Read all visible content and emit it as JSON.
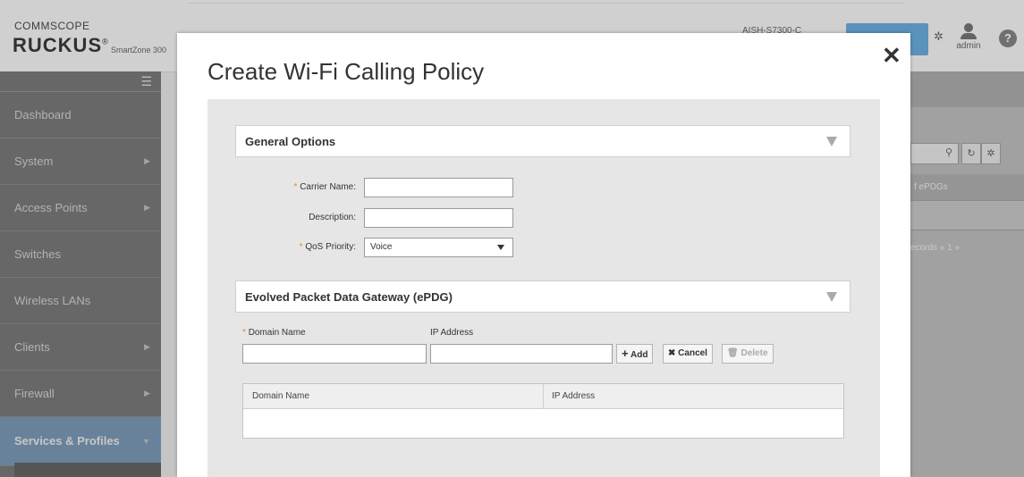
{
  "app": {
    "brand_top": "COMMSCOPE",
    "brand_main": "RUCKUS",
    "brand_reg": "®",
    "brand_sub": "SmartZone 300",
    "host": "AISH-S7300-C",
    "user": "admin",
    "help": "?"
  },
  "sidebar": {
    "menu_icon": "hamburger-icon",
    "items": [
      {
        "label": "Dashboard",
        "arrow": ""
      },
      {
        "label": "System",
        "arrow": "▶"
      },
      {
        "label": "Access Points",
        "arrow": "▶"
      },
      {
        "label": "Switches",
        "arrow": ""
      },
      {
        "label": "Wireless LANs",
        "arrow": ""
      },
      {
        "label": "Clients",
        "arrow": "▶"
      },
      {
        "label": "Firewall",
        "arrow": "▶"
      },
      {
        "label": "Services & Profiles",
        "arrow": "▼"
      }
    ]
  },
  "background_table": {
    "column": "f ePDGs",
    "records": "ecords  «  1  »"
  },
  "modal": {
    "title": "Create Wi-Fi Calling Policy",
    "close": "✕",
    "general": {
      "title": "General Options",
      "carrier_label": "Carrier Name:",
      "carrier_value": "",
      "description_label": "Description:",
      "description_value": "",
      "qos_label": "QoS Priority:",
      "qos_value": "Voice"
    },
    "epdg": {
      "title": "Evolved Packet Data Gateway (ePDG)",
      "domain_label": "Domain Name",
      "ip_label": "IP Address",
      "add": "Add",
      "cancel": "Cancel",
      "delete": "Delete",
      "table_columns": [
        "Domain Name",
        "IP Address"
      ]
    }
  },
  "colors": {
    "required": "#e08a2d",
    "accent": "#5aa5dd"
  }
}
